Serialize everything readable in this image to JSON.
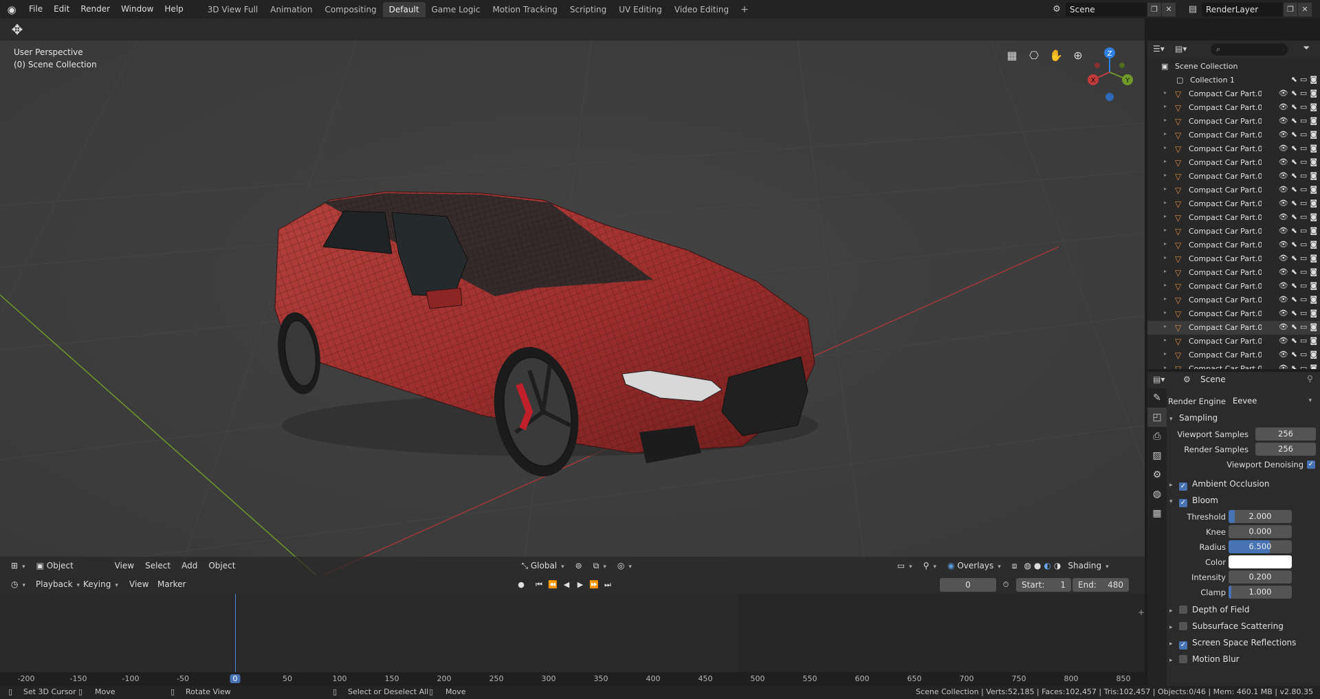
{
  "topbar": {
    "menus": [
      "File",
      "Edit",
      "Render",
      "Window",
      "Help"
    ],
    "workspaces": [
      "3D View Full",
      "Animation",
      "Compositing",
      "Default",
      "Game Logic",
      "Motion Tracking",
      "Scripting",
      "UV Editing",
      "Video Editing"
    ],
    "active_workspace": "Default",
    "add_tab": "+",
    "scene": "Scene",
    "render_layer": "RenderLayer"
  },
  "viewport": {
    "perspective": "User Perspective",
    "collection": "(0) Scene Collection",
    "gizmo": {
      "x": "X",
      "y": "Y",
      "z": "Z"
    },
    "header": {
      "mode": "Object Mode",
      "menus": [
        "View",
        "Select",
        "Add",
        "Object"
      ],
      "orientation": "Global",
      "overlays": "Overlays",
      "shading": "Shading"
    }
  },
  "timeline": {
    "menus": [
      "Playback",
      "Keying",
      "View",
      "Marker"
    ],
    "current_frame": "0",
    "start_label": "Start:",
    "start": "1",
    "end_label": "End:",
    "end": "480",
    "ruler": [
      "-200",
      "-150",
      "-100",
      "-50",
      "0",
      "50",
      "100",
      "150",
      "200",
      "250",
      "300",
      "350",
      "400",
      "450",
      "500",
      "550",
      "600",
      "650",
      "700",
      "750",
      "800",
      "850"
    ]
  },
  "outliner": {
    "root": "Scene Collection",
    "collection": "Collection 1",
    "items": [
      "Compact Car Part.0(",
      "Compact Car Part.0(",
      "Compact Car Part.0(",
      "Compact Car Part.0(",
      "Compact Car Part.0",
      "Compact Car Part.0",
      "Compact Car Part.0",
      "Compact Car Part.0",
      "Compact Car Part.0",
      "Compact Car Part.0",
      "Compact Car Part.0",
      "Compact Car Part.0",
      "Compact Car Part.0",
      "Compact Car Part.0",
      "Compact Car Part.0",
      "Compact Car Part.0",
      "Compact Car Part.0",
      "Compact Car Part.0",
      "Compact Car Part.0",
      "Compact Car Part.0",
      "Compact Car Part.0"
    ],
    "selected_index": 17
  },
  "properties": {
    "context": "Scene",
    "render_engine_label": "Render Engine",
    "render_engine": "Eevee",
    "sampling": {
      "title": "Sampling",
      "viewport_samples_label": "Viewport Samples",
      "viewport_samples": "256",
      "render_samples_label": "Render Samples",
      "render_samples": "256",
      "denoise_label": "Viewport Denoising"
    },
    "ambient_occlusion": "Ambient Occlusion",
    "bloom": {
      "title": "Bloom",
      "threshold_label": "Threshold",
      "threshold": "2.000",
      "threshold_fill": 0.1,
      "knee_label": "Knee",
      "knee": "0.000",
      "knee_fill": 0,
      "radius_label": "Radius",
      "radius": "6.500",
      "radius_fill": 0.65,
      "color_label": "Color",
      "color": "#ffffff",
      "intensity_label": "Intensity",
      "intensity": "0.200",
      "intensity_fill": 0,
      "clamp_label": "Clamp",
      "clamp": "1.000",
      "clamp_fill": 0.04
    },
    "depth_of_field": "Depth of Field",
    "subsurface": "Subsurface Scattering",
    "ssr": "Screen Space Reflections",
    "motion_blur": "Motion Blur"
  },
  "statusbar": {
    "set_cursor": "Set 3D Cursor",
    "move1": "Move",
    "rotate": "Rotate View",
    "select": "Select or Deselect All",
    "move2": "Move",
    "stats": "Scene Collection | Verts:52,185 | Faces:102,457 | Tris:102,457 | Objects:0/46 | Mem: 460.1 MB | v2.80.35"
  },
  "colors": {
    "accent": "#4772b3",
    "car_body": "#a3302e",
    "x_axis": "#c23b3b",
    "y_axis": "#6f9a2a",
    "z_axis": "#2f80e0"
  }
}
